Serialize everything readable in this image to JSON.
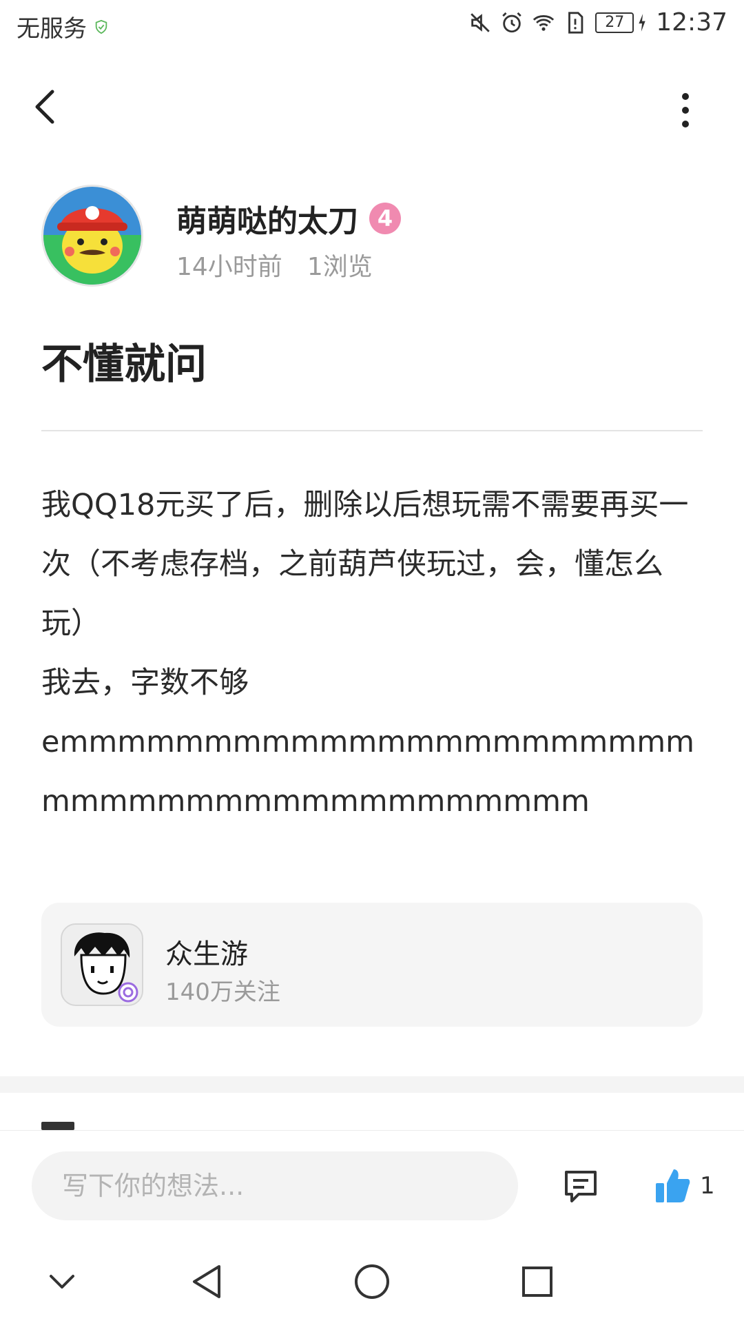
{
  "status_bar": {
    "carrier": "无服务",
    "battery": "27",
    "time": "12:37",
    "icons": [
      "shield-check-icon",
      "mute-icon",
      "alarm-icon",
      "wifi-icon",
      "sim-alert-icon",
      "battery-icon",
      "charging-icon"
    ]
  },
  "nav": {
    "back_icon": "chevron-left-icon",
    "more_icon": "more-vertical-icon"
  },
  "author": {
    "name": "萌萌哒的太刀",
    "level": "4",
    "time_ago": "14小时前",
    "views": "1浏览"
  },
  "post": {
    "title": "不懂就问",
    "body": "我QQ18元买了后，删除以后想玩需不需要再买一次（不考虑存档，之前葫芦侠玩过，会，懂怎么玩）\n我去，字数不够\nemmmmmmmmmmmmmmmmmmmmmmmmmmmmmmmmmmmmmmmmm"
  },
  "game_card": {
    "name": "众生游",
    "followers": "140万关注"
  },
  "bottom_bar": {
    "comment_placeholder": "写下你的想法...",
    "like_count": "1"
  },
  "colors": {
    "accent_blue": "#3aa3f0",
    "level_badge": "#f08ab0",
    "meta_gray": "#9a9a9a"
  }
}
